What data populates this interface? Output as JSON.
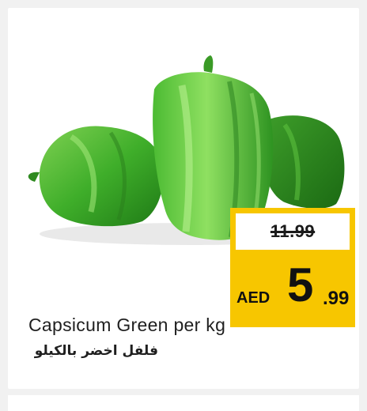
{
  "product": {
    "name": "Capsicum Green per kg",
    "name_ar": "فلفل اخضر بالكيلو",
    "image_icon": "green-capsicum-image"
  },
  "pricing": {
    "old_price": "11.99",
    "currency": "AED",
    "price_integer": "5",
    "price_decimal": ".99",
    "badge_color": "#f7c600"
  }
}
